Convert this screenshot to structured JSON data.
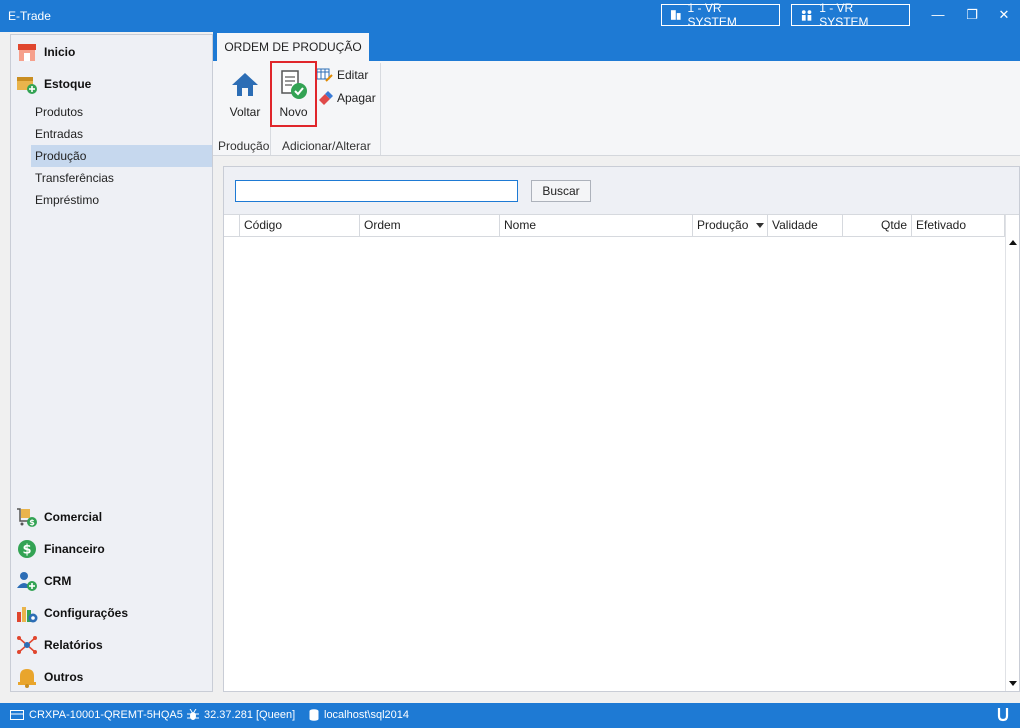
{
  "window": {
    "title": "E-Trade",
    "buttons": [
      {
        "label": "1 - VR SYSTEM",
        "icon": "building-icon"
      },
      {
        "label": "1 - VR SYSTEM",
        "icon": "users-icon"
      }
    ],
    "controls": {
      "minimize": "—",
      "restore": "❐",
      "close": "✕"
    }
  },
  "sidebar": {
    "sections": [
      {
        "label": "Inicio",
        "icon": "store-icon"
      },
      {
        "label": "Estoque",
        "icon": "box-add-icon"
      }
    ],
    "estoque_items": [
      "Produtos",
      "Entradas",
      "Produção",
      "Transferências",
      "Empréstimo"
    ],
    "active_item": "Produção",
    "bottom_sections": [
      {
        "label": "Comercial",
        "icon": "cart-icon"
      },
      {
        "label": "Financeiro",
        "icon": "dollar-icon"
      },
      {
        "label": "CRM",
        "icon": "user-add-icon"
      },
      {
        "label": "Configurações",
        "icon": "settings-chart-icon"
      },
      {
        "label": "Relatórios",
        "icon": "network-icon"
      },
      {
        "label": "Outros",
        "icon": "bell-icon"
      }
    ]
  },
  "ribbon": {
    "tab": "ORDEM DE PRODUÇÃO",
    "groups": [
      {
        "label": "Produção"
      },
      {
        "label": "Adicionar/Alterar"
      }
    ],
    "voltar_label": "Voltar",
    "novo_label": "Novo",
    "editar_label": "Editar",
    "apagar_label": "Apagar"
  },
  "search": {
    "value": "",
    "button": "Buscar"
  },
  "grid": {
    "columns": [
      "Código",
      "Ordem",
      "Nome",
      "Produção",
      "Validade",
      "Qtde",
      "Efetivado"
    ],
    "sorted_column": "Produção"
  },
  "status": {
    "license": "CRXPA-10001-QREMT-5HQA5",
    "version": "32.37.281 [Queen]",
    "database": "localhost\\sql2014"
  },
  "colors": {
    "accent": "#1e7ad4",
    "highlight": "#c6d8ee",
    "novo_border": "#e0262b"
  }
}
